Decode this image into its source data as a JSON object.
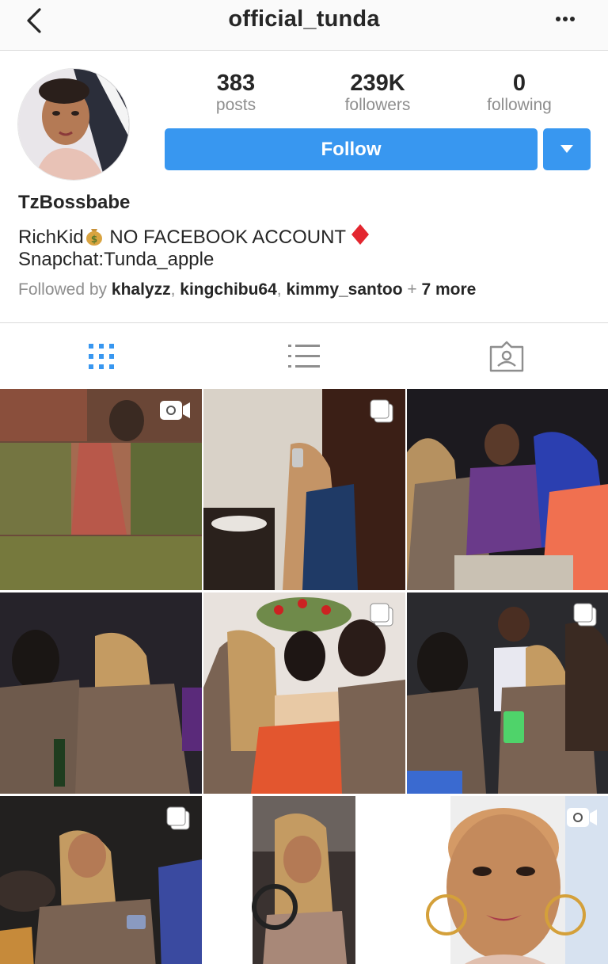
{
  "header": {
    "username": "official_tunda",
    "back_icon": "chevron-left-icon",
    "more_icon": "ellipsis-horizontal-icon"
  },
  "profile": {
    "stats": [
      {
        "value": "383",
        "label": "posts"
      },
      {
        "value": "239K",
        "label": "followers"
      },
      {
        "value": "0",
        "label": "following"
      }
    ],
    "follow_label": "Follow",
    "accent_color": "#3897f0",
    "display_name": "TzBossbabe",
    "bio_line1_a": "RichKid",
    "bio_line1_b": " NO FACEBOOK ACCOUNT ",
    "bio_line2": "Snapchat:Tunda_apple",
    "followed_by_prefix": "Followed by ",
    "followers_shown": [
      "khalyzz",
      "kingchibu64",
      "kimmy_santoo"
    ],
    "followed_by_more": "7 more"
  },
  "tabs": [
    {
      "name": "grid-view",
      "icon": "grid-icon",
      "active": true
    },
    {
      "name": "list-view",
      "icon": "list-icon",
      "active": false
    },
    {
      "name": "tagged",
      "icon": "tagged-person-icon",
      "active": false
    }
  ],
  "posts": [
    {
      "badge": "video-icon"
    },
    {
      "badge": "carousel-icon"
    },
    {
      "badge": ""
    },
    {
      "badge": ""
    },
    {
      "badge": "carousel-icon"
    },
    {
      "badge": "carousel-icon"
    },
    {
      "badge": "carousel-icon"
    },
    {
      "badge": ""
    },
    {
      "badge": "video-icon"
    }
  ]
}
